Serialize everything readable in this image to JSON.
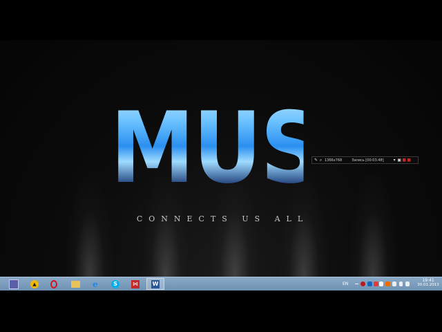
{
  "wallpaper": {
    "main_text": "MUSIC",
    "tagline": "CONNECTS US ALL"
  },
  "recorder": {
    "resolution": "1366x768",
    "record_label": "Запись [00:03:48]"
  },
  "taskbar": {
    "apps": [
      {
        "name": "save-disk",
        "icon": "floppy-icon",
        "color": "#5a5fa8"
      },
      {
        "name": "aimp",
        "icon": "aimp-icon",
        "color": "#f2b705"
      },
      {
        "name": "opera",
        "icon": "opera-icon",
        "color": "#d8121b"
      },
      {
        "name": "file-explorer",
        "icon": "folder-icon",
        "color": "#e9c35a"
      },
      {
        "name": "internet-explorer",
        "icon": "ie-icon",
        "color": "#1e88e5"
      },
      {
        "name": "skype",
        "icon": "skype-icon",
        "color": "#00aff0"
      },
      {
        "name": "visual-studio",
        "icon": "vs-icon",
        "color": "#c62828"
      },
      {
        "name": "word",
        "icon": "word-icon",
        "color": "#2b579a"
      }
    ],
    "language": "EN",
    "time": "19:41",
    "date": "30.01.2013"
  }
}
